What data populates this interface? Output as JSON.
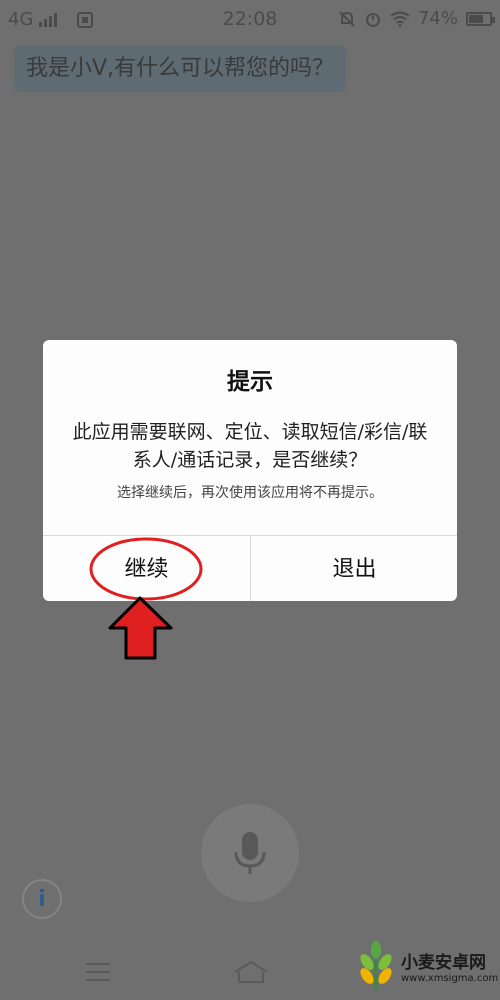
{
  "status_bar": {
    "network": "4G",
    "time": "22:08",
    "battery": "74%",
    "battery_level": 0.74
  },
  "chat": {
    "greeting": "我是小V,有什么可以帮您的吗？"
  },
  "dialog": {
    "title": "提示",
    "message": "此应用需要联网、定位、读取短信/彩信/联系人/通话记录，是否继续？",
    "note": "选择继续后，再次使用该应用将不再提示。",
    "continue_label": "继续",
    "exit_label": "退出"
  },
  "info_button": {
    "label": "i"
  },
  "watermark": {
    "name": "小麦安卓网",
    "url": "www.xmsigma.com"
  },
  "colors": {
    "annotation_red": "#e02020",
    "info_blue": "#2d5d8c"
  }
}
